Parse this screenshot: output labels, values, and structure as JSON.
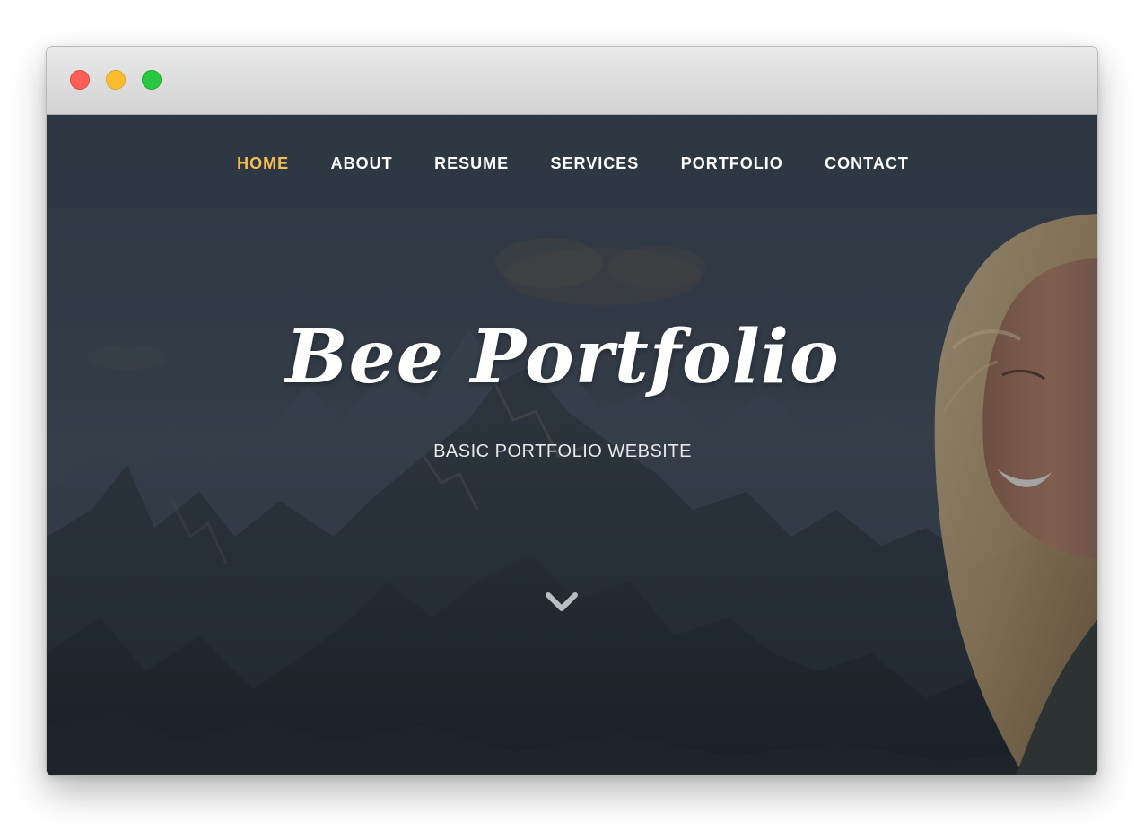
{
  "window": {
    "controls": [
      "close-button",
      "minimize-button",
      "zoom-button"
    ]
  },
  "nav": {
    "items": [
      {
        "label": "HOME",
        "active": true
      },
      {
        "label": "ABOUT",
        "active": false
      },
      {
        "label": "RESUME",
        "active": false
      },
      {
        "label": "SERVICES",
        "active": false
      },
      {
        "label": "PORTFOLIO",
        "active": false
      },
      {
        "label": "CONTACT",
        "active": false
      }
    ]
  },
  "hero": {
    "title": "Bee Portfolio",
    "subtitle": "BASIC PORTFOLIO WEBSITE",
    "scroll_icon": "chevron-down-icon"
  },
  "colors": {
    "accent": "#f6bd51",
    "text": "#ffffff",
    "close": "#fe5f57",
    "minimize": "#febc2e",
    "zoom": "#28c840"
  }
}
